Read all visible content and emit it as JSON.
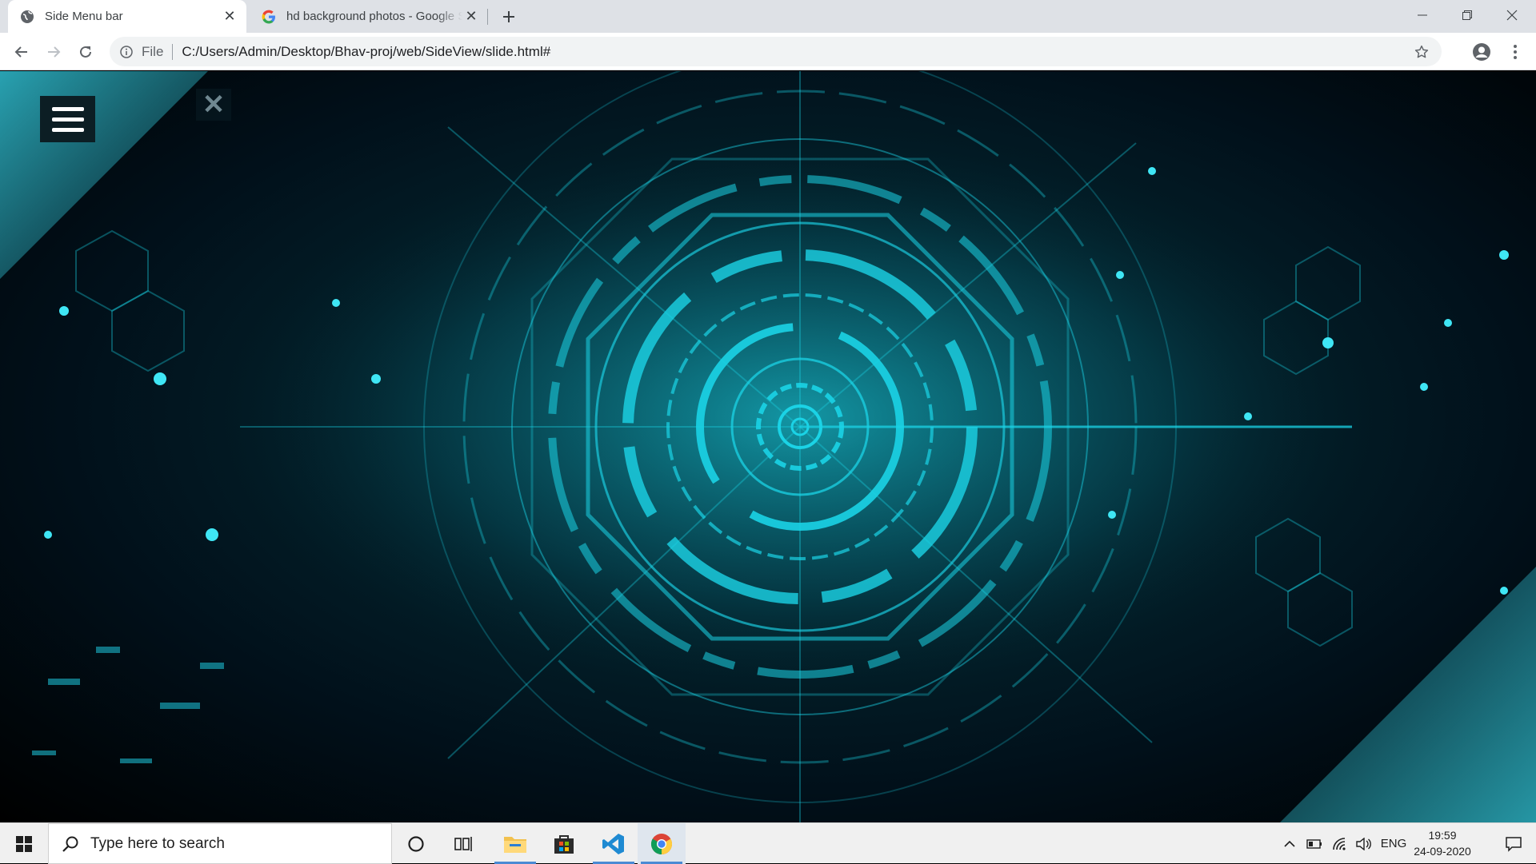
{
  "browser": {
    "tabs": [
      {
        "title": "Side Menu bar",
        "active": true,
        "favicon": "globe-icon"
      },
      {
        "title": "hd background photos - Google Search",
        "active": false,
        "favicon": "google-g-icon"
      }
    ],
    "new_tab_label": "+",
    "window_controls": [
      "minimize-icon",
      "restore-icon",
      "close-icon"
    ],
    "omnibox": {
      "scheme_label": "File",
      "url": "C:/Users/Admin/Desktop/Bhav-proj/web/SideView/slide.html#"
    }
  },
  "page": {
    "menu_button": "hamburger-icon",
    "close_button_glyph": "✕",
    "background": "cyan-technology-circuit-hud",
    "accent_color": "#1bd3e6"
  },
  "taskbar": {
    "search_placeholder": "Type here to search",
    "pinned": [
      "cortana-icon",
      "task-view-icon",
      "file-explorer-icon",
      "store-icon",
      "vscode-icon",
      "chrome-icon"
    ],
    "tray": {
      "language": "ENG",
      "time": "19:59",
      "date": "24-09-2020"
    }
  }
}
